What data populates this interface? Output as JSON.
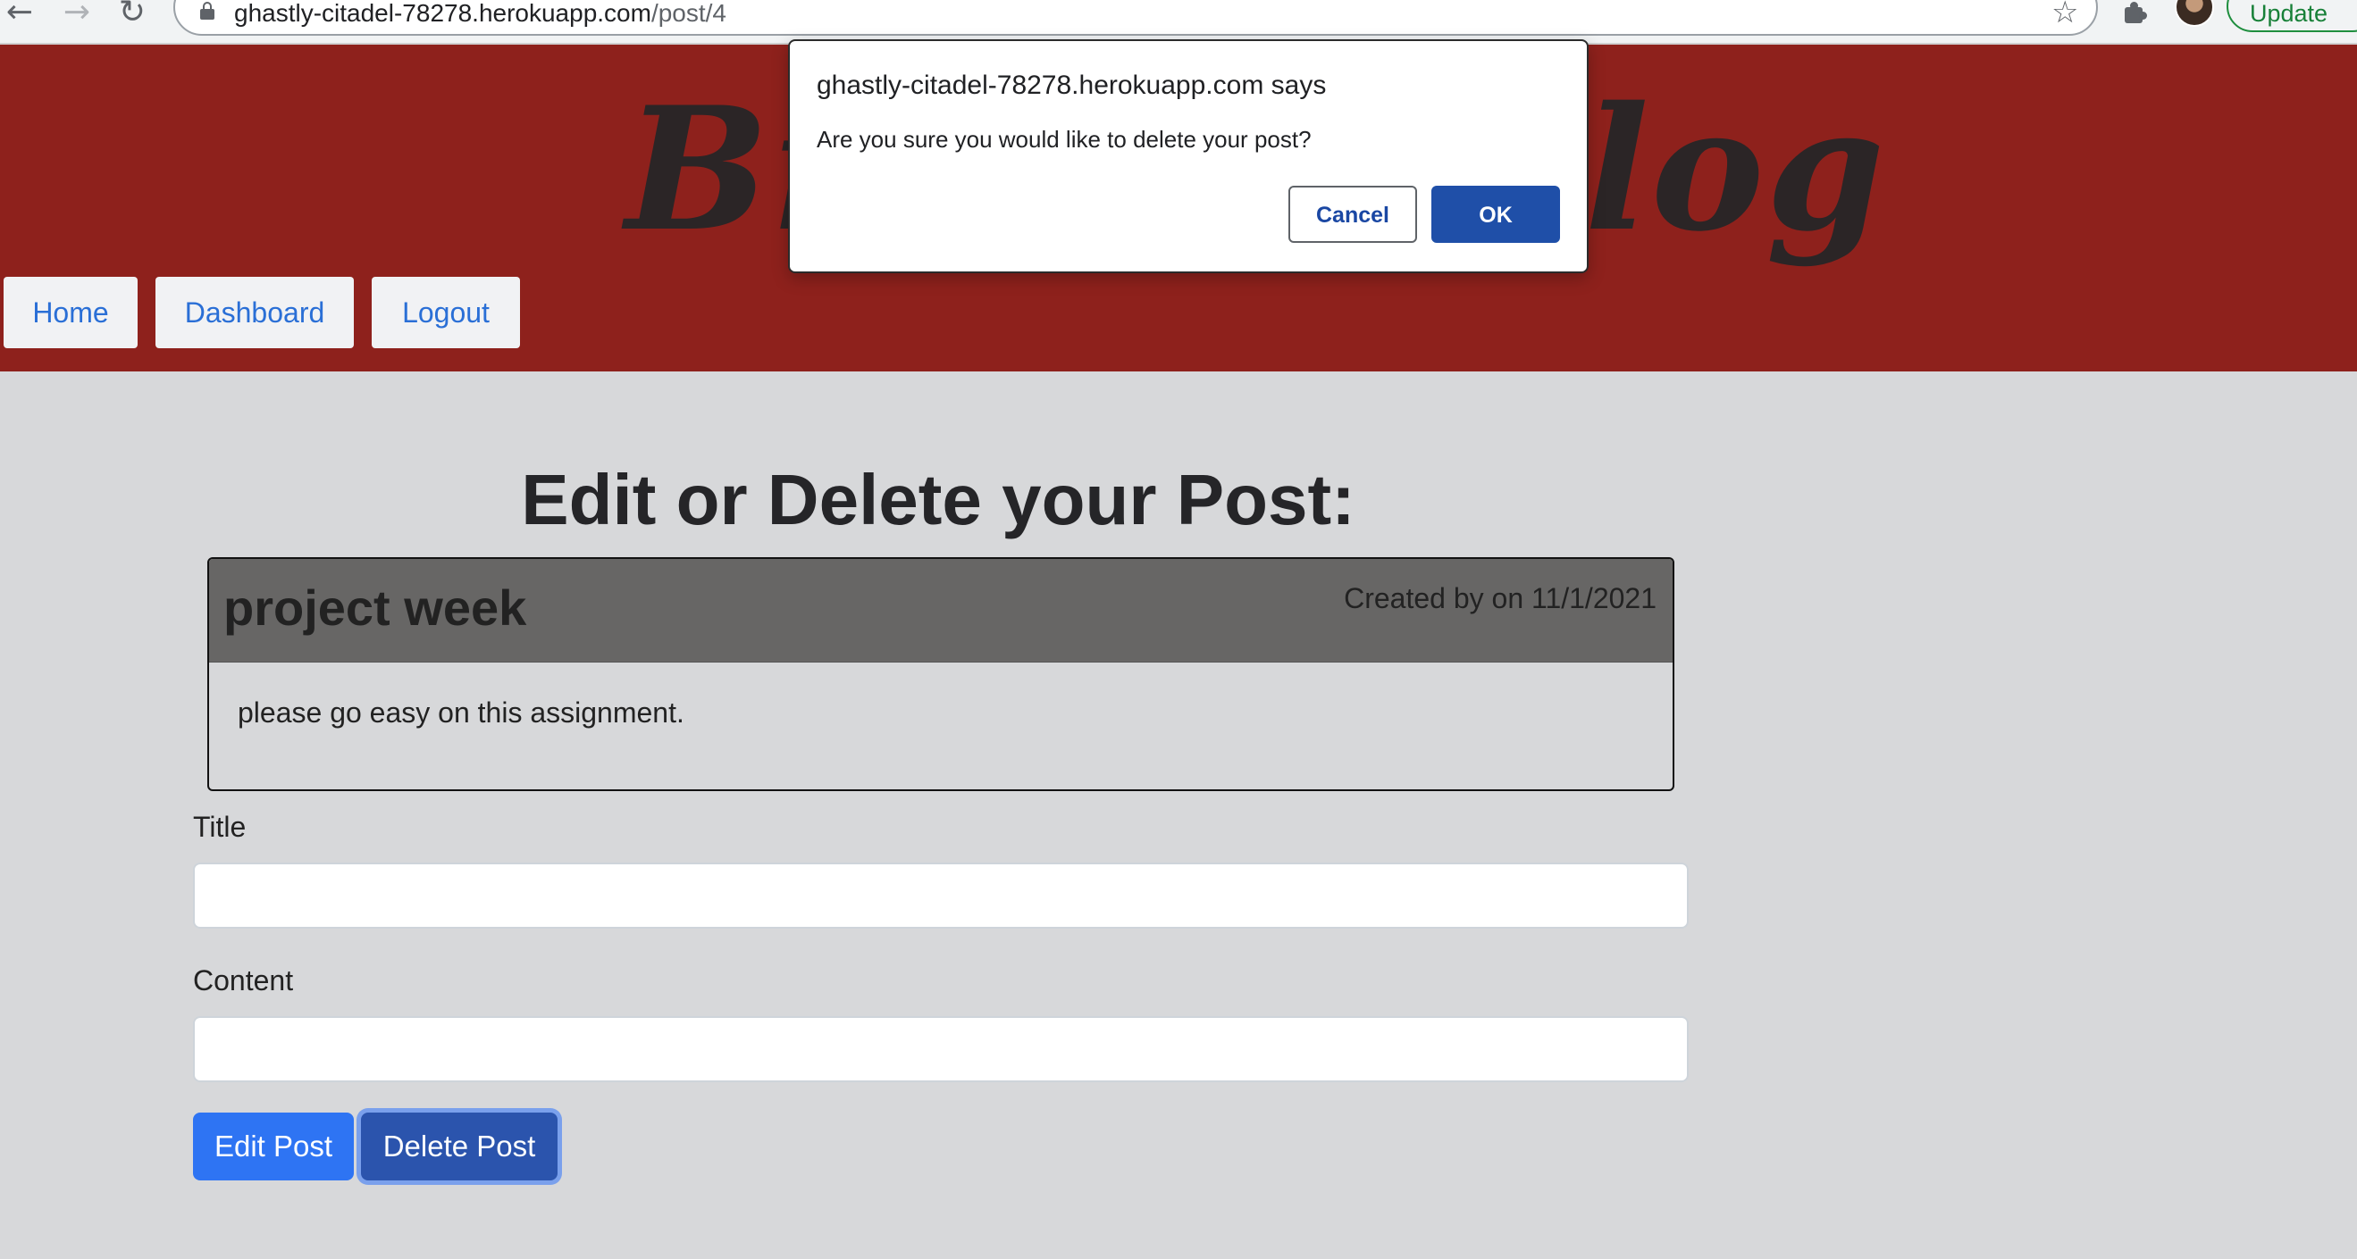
{
  "browser": {
    "url_host": "ghastly-citadel-78278.herokuapp.com",
    "url_path": "/post/4",
    "back_icon": "back-arrow-icon",
    "forward_icon": "forward-arrow-icon",
    "reload_icon": "reload-icon",
    "update_label": "Update"
  },
  "header": {
    "brand": "Bruno's Blog",
    "nav": [
      "Home",
      "Dashboard",
      "Logout"
    ],
    "background": "#8e211c"
  },
  "main": {
    "page_title": "Edit or Delete your Post:",
    "post": {
      "title": "project week",
      "meta": "Created by on 11/1/2021",
      "body": "please go easy on this assignment."
    },
    "form": {
      "title_label": "Title",
      "title_value": "",
      "content_label": "Content",
      "content_value": "",
      "edit_label": "Edit Post",
      "delete_label": "Delete Post"
    }
  },
  "dialog": {
    "title": "ghastly-citadel-78278.herokuapp.com says",
    "message": "Are you sure you would like to delete your post?",
    "cancel_label": "Cancel",
    "ok_label": "OK"
  },
  "colors": {
    "primary": "#2e74f3",
    "primary_active": "#2b54ad",
    "page_bg": "#d7d8da",
    "card_header": "#676665"
  }
}
